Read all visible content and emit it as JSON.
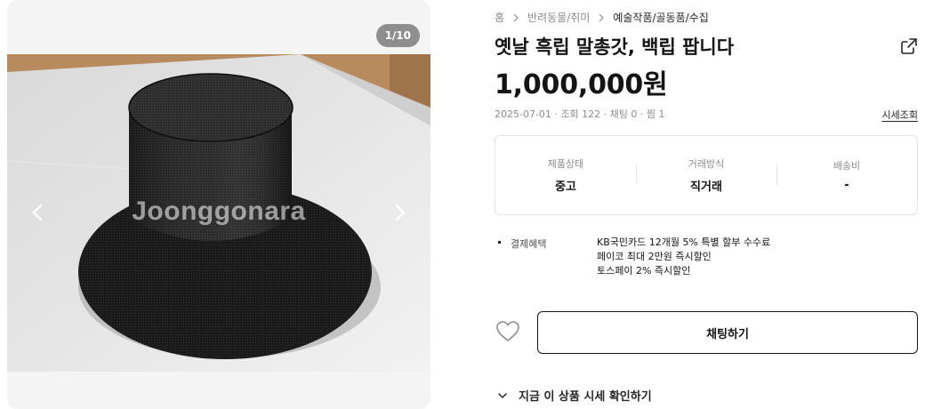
{
  "gallery": {
    "counter": "1/10",
    "watermark": "Joonggonara"
  },
  "breadcrumb": [
    {
      "label": "홈"
    },
    {
      "label": "반려동물/취미"
    },
    {
      "label": "예술작품/골동품/수집"
    }
  ],
  "product": {
    "title": "옛날 흑립 말총갓, 백립 팝니다",
    "price": "1,000,000원",
    "meta": "2025-07-01 · 조회 122 · 채팅 0 · 찜 1",
    "market_link": "시세조회"
  },
  "info": [
    {
      "label": "제품상태",
      "value": "중고"
    },
    {
      "label": "거래방식",
      "value": "직거래"
    },
    {
      "label": "배송비",
      "value": "-"
    }
  ],
  "benefit": {
    "label": "결제혜택",
    "lines": [
      "KB국민카드 12개월 5% 특별 할부 수수료",
      "페이코 최대 2만원 즉시할인",
      "토스페이 2% 즉시할인"
    ]
  },
  "actions": {
    "chat_label": "채팅하기",
    "market_toggle": "지금 이 상품 시세 확인하기"
  },
  "icons": {
    "share": "share-icon",
    "like": "heart-outline-icon",
    "prev": "chevron-left-icon",
    "next": "chevron-right-icon",
    "toggle": "chevron-down-icon"
  }
}
